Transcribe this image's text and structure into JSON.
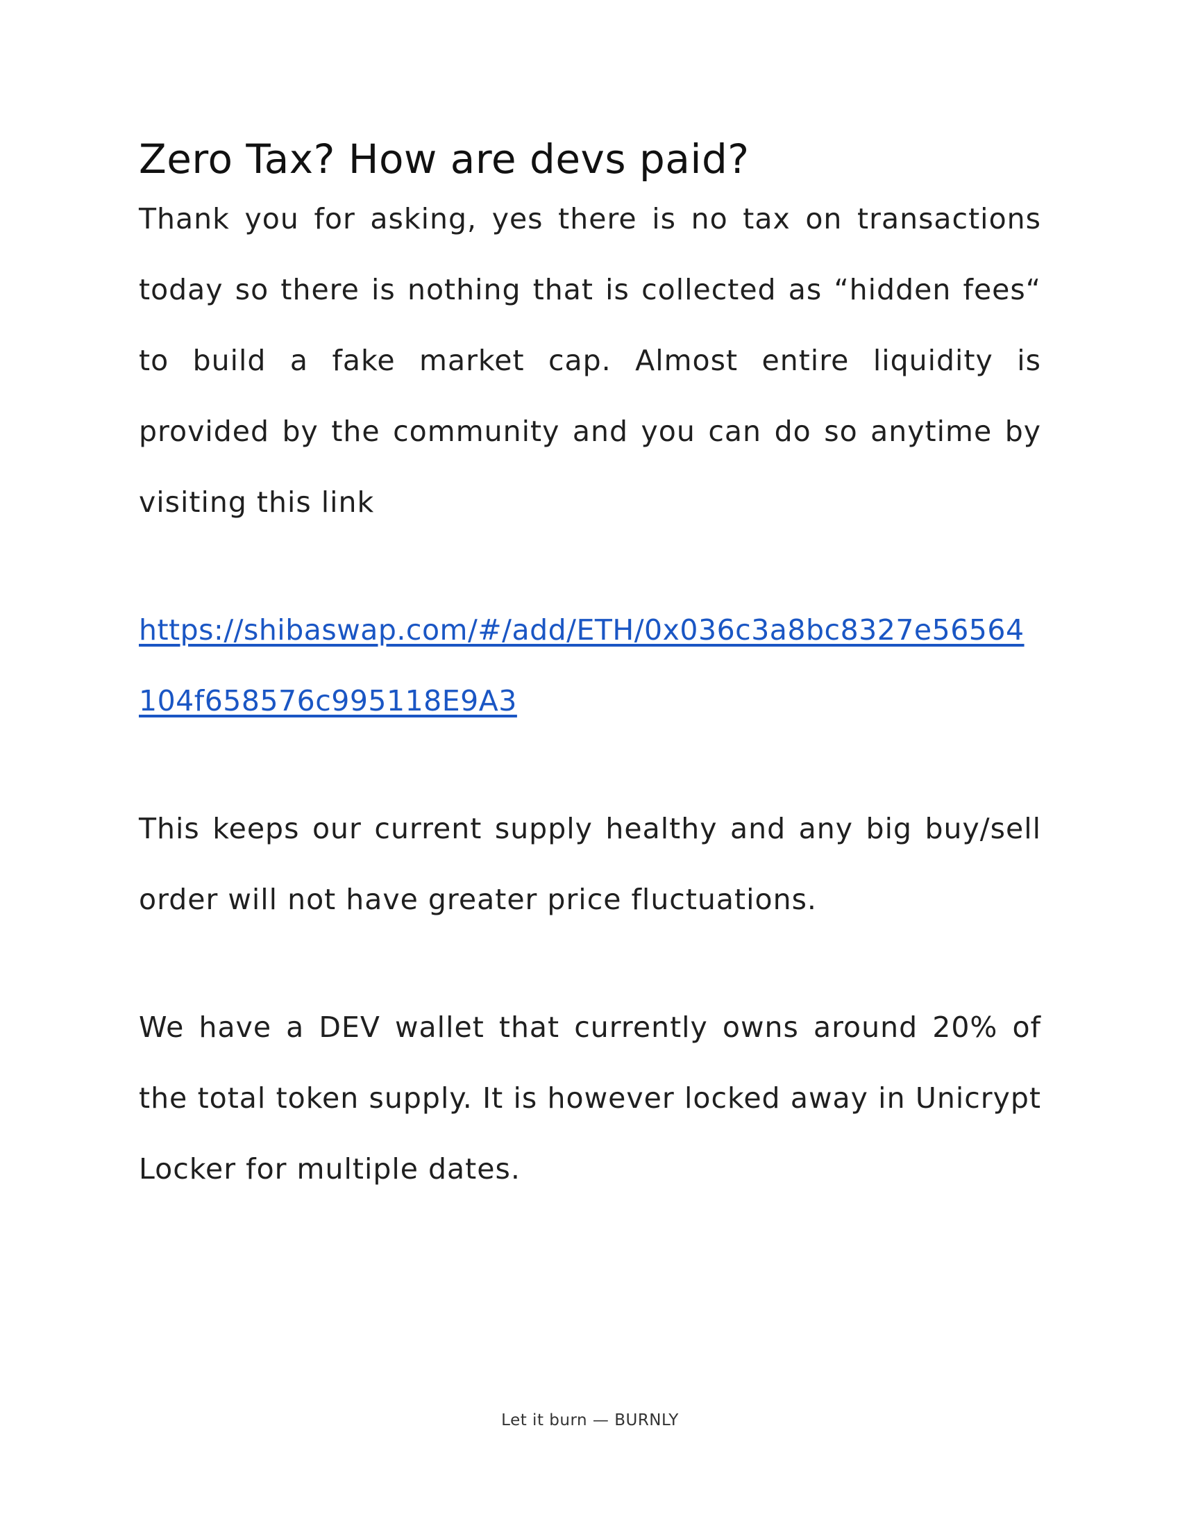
{
  "document": {
    "heading": "Zero Tax? How are devs paid?",
    "paragraph_1": "Thank you for asking, yes there is no tax on transactions today so there is nothing that is collected as “hidden fees“ to build a fake market cap. Almost entire liquidity is provided by the community and you can do so anytime by visiting this link",
    "link_text": "https://shibaswap.com/#/add/ETH/0x036c3a8bc8327e56564104f658576c995118E9A3",
    "paragraph_2": "This keeps our current supply healthy and any big buy/sell order will not have greater price fluctuations.",
    "paragraph_3": "We have a DEV wallet that currently owns around 20% of the total token supply. It is however locked away in Unicrypt Locker for multiple dates.",
    "footer": "Let it burn — BURNLY"
  },
  "colors": {
    "link": "#1a56c4",
    "text": "#1f1f1f",
    "background": "#ffffff"
  }
}
